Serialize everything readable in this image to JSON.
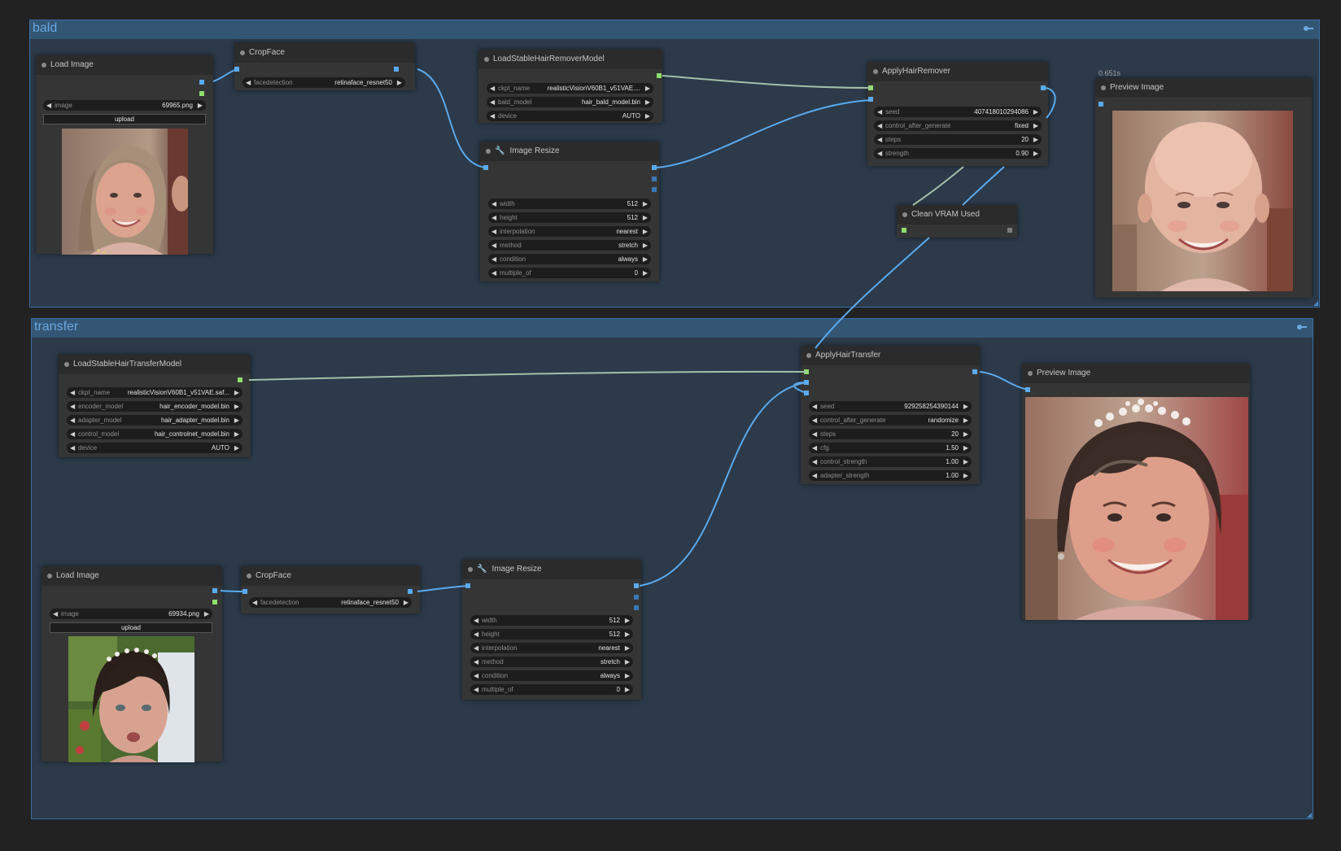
{
  "groups": {
    "bald": {
      "title": "bald"
    },
    "transfer": {
      "title": "transfer"
    }
  },
  "nodes": {
    "load_image_1": {
      "title": "Load Image",
      "image_label": "image",
      "image_value": "69965.png",
      "upload_label": "upload"
    },
    "cropface_1": {
      "title": "CropFace",
      "fd_label": "facedetection",
      "fd_value": "retinaface_resnet50"
    },
    "remover_model": {
      "title": "LoadStableHairRemoverModel",
      "ckpt_label": "ckpt_name",
      "ckpt_value": "realisticVisionV60B1_v51VAE....",
      "bald_label": "bald_model",
      "bald_value": "hair_bald_model.bin",
      "device_label": "device",
      "device_value": "AUTO"
    },
    "resize_1": {
      "title": "Image Resize",
      "width_label": "width",
      "width_value": "512",
      "height_label": "height",
      "height_value": "512",
      "interp_label": "interpolation",
      "interp_value": "nearest",
      "method_label": "method",
      "method_value": "stretch",
      "cond_label": "condition",
      "cond_value": "always",
      "mult_label": "multiple_of",
      "mult_value": "0"
    },
    "apply_remover": {
      "title": "ApplyHairRemover",
      "seed_label": "seed",
      "seed_value": "407418010294086",
      "cag_label": "control_after_generate",
      "cag_value": "fixed",
      "steps_label": "steps",
      "steps_value": "20",
      "strength_label": "strength",
      "strength_value": "0.90"
    },
    "clean_vram": {
      "title": "Clean VRAM Used"
    },
    "preview_1": {
      "title": "Preview Image",
      "timer": "0.651s"
    },
    "transfer_model": {
      "title": "LoadStableHairTransferModel",
      "ckpt_label": "ckpt_name",
      "ckpt_value": "realisticVisionV60B1_v51VAE.saf...",
      "enc_label": "encoder_model",
      "enc_value": "hair_encoder_model.bin",
      "adp_label": "adapter_model",
      "adp_value": "hair_adapter_model.bin",
      "ctl_label": "control_model",
      "ctl_value": "hair_controlnet_model.bin",
      "device_label": "device",
      "device_value": "AUTO"
    },
    "apply_transfer": {
      "title": "ApplyHairTransfer",
      "seed_label": "seed",
      "seed_value": "929258254390144",
      "cag_label": "control_after_generate",
      "cag_value": "randomize",
      "steps_label": "steps",
      "steps_value": "20",
      "cfg_label": "cfg",
      "cfg_value": "1.50",
      "cs_label": "control_strength",
      "cs_value": "1.00",
      "as_label": "adapter_strength",
      "as_value": "1.00"
    },
    "preview_2": {
      "title": "Preview Image"
    },
    "load_image_2": {
      "title": "Load Image",
      "image_label": "image",
      "image_value": "69934.png",
      "upload_label": "upload"
    },
    "cropface_2": {
      "title": "CropFace",
      "fd_label": "facedetection",
      "fd_value": "retinaface_resnet50"
    },
    "resize_2": {
      "title": "Image Resize",
      "width_label": "width",
      "width_value": "512",
      "height_label": "height",
      "height_value": "512",
      "interp_label": "interpolation",
      "interp_value": "nearest",
      "method_label": "method",
      "method_value": "stretch",
      "cond_label": "condition",
      "cond_value": "always",
      "mult_label": "multiple_of",
      "mult_value": "0"
    }
  },
  "colors": {
    "link_image": "#5aaaee",
    "link_model": "#a3bfa6",
    "group_border": "#3a6ea5",
    "group_head": "#335675"
  }
}
